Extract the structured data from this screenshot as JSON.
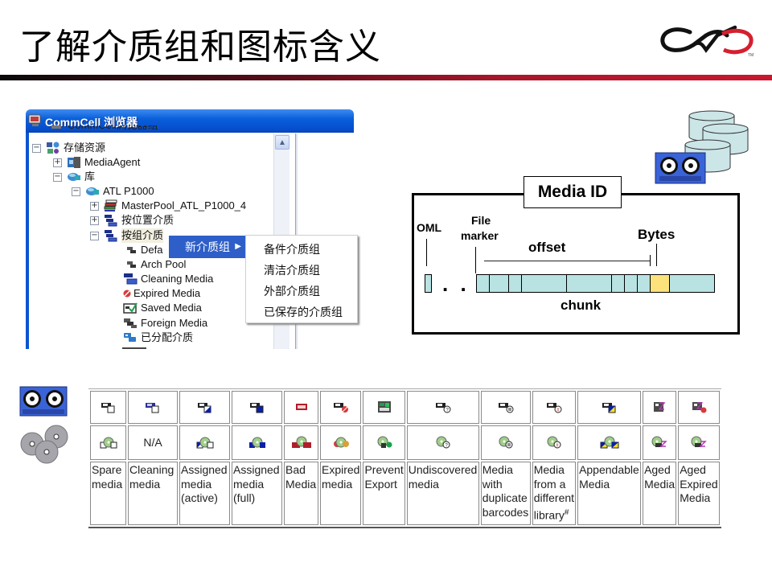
{
  "slide": {
    "title": "了解介质组和图标含义",
    "logo": "commvault-logo",
    "header_bar_colors": [
      "#0a0a0a",
      "#c8182e"
    ]
  },
  "explorer": {
    "window_title": "CommCell 浏览器",
    "tree": [
      {
        "label": "CommCell浏览器组",
        "level": 1,
        "expander": null,
        "icon": "computer-group-icon",
        "partial": true
      },
      {
        "label": "存储资源",
        "level": 1,
        "expander": "minus",
        "icon": "storage-resources-icon"
      },
      {
        "label": "MediaAgent",
        "level": 2,
        "expander": "plus",
        "icon": "media-agent-icon"
      },
      {
        "label": "库",
        "level": 2,
        "expander": "minus",
        "icon": "library-icon"
      },
      {
        "label": "ATL P1000",
        "level": 3,
        "expander": "minus",
        "icon": "library-icon"
      },
      {
        "label": "MasterPool_ATL_P1000_4",
        "level": 4,
        "expander": "plus",
        "icon": "master-pool-icon"
      },
      {
        "label": "按位置介质",
        "level": 4,
        "expander": "plus",
        "icon": "media-by-location-icon"
      },
      {
        "label": "按组介质",
        "level": 4,
        "expander": "minus",
        "icon": "media-by-group-icon"
      },
      {
        "label": "Defa",
        "level": 5,
        "expander": null,
        "icon": "media-group-icon"
      },
      {
        "label": "Arch Pool",
        "level": 5,
        "expander": null,
        "icon": "media-group-icon"
      },
      {
        "label": "Cleaning Media",
        "level": 5,
        "expander": null,
        "icon": "cleaning-media-icon"
      },
      {
        "label": "Expired Media",
        "level": 5,
        "expander": null,
        "icon": "expired-media-icon"
      },
      {
        "label": "Saved Media",
        "level": 5,
        "expander": null,
        "icon": "saved-media-icon"
      },
      {
        "label": "Foreign Media",
        "level": 5,
        "expander": null,
        "icon": "foreign-media-icon"
      },
      {
        "label": "已分配介质",
        "level": 5,
        "expander": null,
        "icon": "assigned-media-icon"
      }
    ],
    "context_menu": {
      "highlighted_item": "新介质组",
      "submenu": [
        "备件介质组",
        "清洁介质组",
        "外部介质组",
        "已保存的介质组"
      ]
    }
  },
  "diagram": {
    "title": "Media ID",
    "labels": {
      "oml": "OML",
      "file_marker": "File marker",
      "file_line1": "File",
      "file_line2": "marker",
      "offset": "offset",
      "bytes": "Bytes",
      "chunk": "chunk",
      "ellipsis": ". . ."
    },
    "colors": {
      "cell_fill": "#b9e2e3",
      "highlight_fill": "#fbe27a"
    }
  },
  "legend_table": {
    "columns": [
      {
        "label": [
          "Spare",
          "media"
        ],
        "tape_icon": "spare-tape-icon",
        "disk_icon": "spare-disk-icon"
      },
      {
        "label": [
          "Cleaning",
          "media"
        ],
        "tape_icon": "cleaning-tape-icon",
        "disk_text": "N/A"
      },
      {
        "label": [
          "Assigned",
          "media",
          "(active)"
        ],
        "tape_icon": "assigned-active-tape-icon",
        "disk_icon": "assigned-active-disk-icon"
      },
      {
        "label": [
          "Assigned",
          "media",
          "(full)"
        ],
        "tape_icon": "assigned-full-tape-icon",
        "disk_icon": "assigned-full-disk-icon"
      },
      {
        "label": [
          "Bad",
          "Media"
        ],
        "tape_icon": "bad-tape-icon",
        "disk_icon": "bad-disk-icon"
      },
      {
        "label": [
          "Expired",
          "media"
        ],
        "tape_icon": "expired-tape-icon",
        "disk_icon": "expired-disk-icon"
      },
      {
        "label": [
          "Prevent",
          "Export"
        ],
        "tape_icon": "prevent-export-tape-icon",
        "disk_icon": "prevent-export-disk-icon"
      },
      {
        "label": [
          "Undiscovered",
          "media"
        ],
        "tape_icon": "undiscovered-tape-icon",
        "disk_icon": "undiscovered-disk-icon"
      },
      {
        "label": [
          "Media",
          "with",
          "duplicate",
          "barcodes"
        ],
        "tape_icon": "duplicate-barcode-tape-icon",
        "disk_icon": "duplicate-barcode-disk-icon"
      },
      {
        "label": [
          "Media",
          "from a",
          "different",
          "library"
        ],
        "footnote": "#",
        "tape_icon": "foreign-library-tape-icon",
        "disk_icon": "foreign-library-disk-icon"
      },
      {
        "label": [
          "Appendable",
          "Media"
        ],
        "tape_icon": "appendable-tape-icon",
        "disk_icon": "appendable-disk-icon"
      },
      {
        "label": [
          "Aged",
          "Media"
        ],
        "tape_icon": "aged-tape-icon",
        "disk_icon": "aged-disk-icon"
      },
      {
        "label": [
          "Aged",
          "Expired",
          "Media"
        ],
        "tape_icon": "aged-expired-tape-icon",
        "disk_icon": "aged-expired-disk-icon"
      }
    ]
  }
}
